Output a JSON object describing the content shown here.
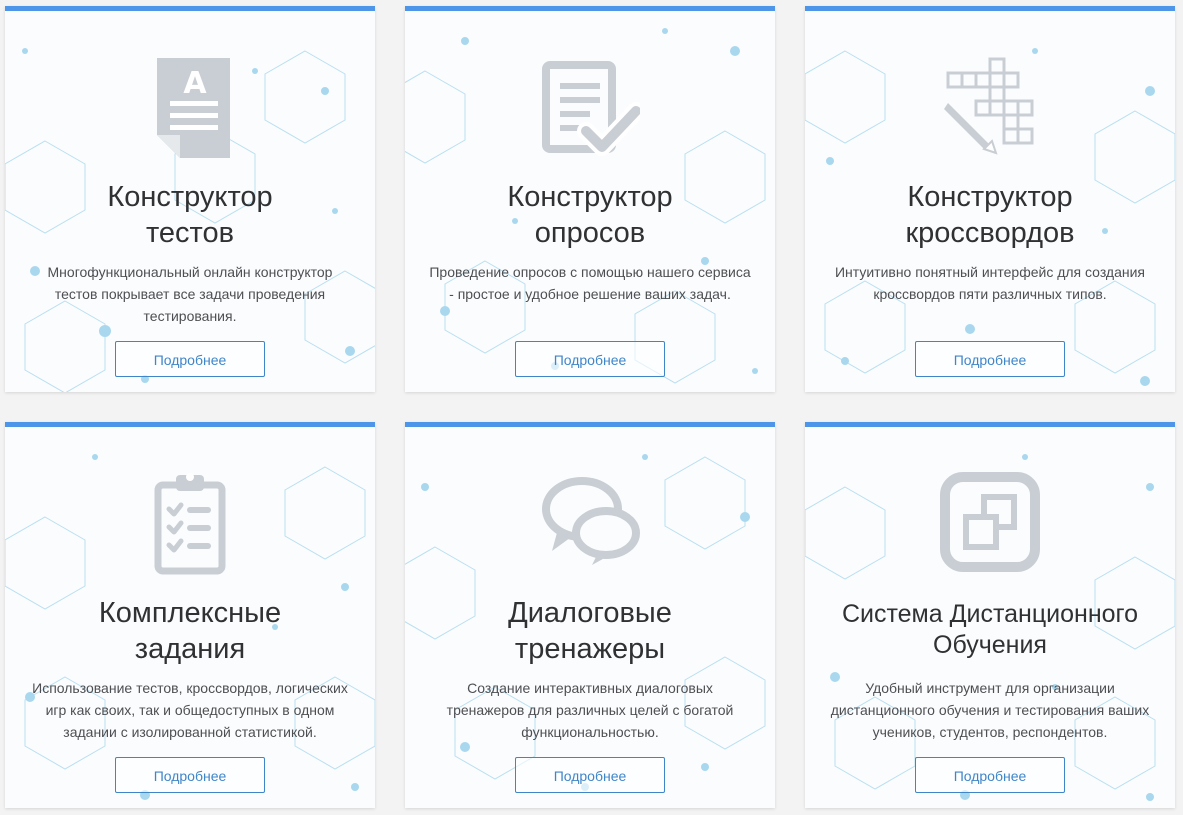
{
  "cards": [
    {
      "title_line1": "Конструктор",
      "title_line2": "тестов",
      "description": "Многофункциональный онлайн конструктор тестов покрывает все задачи проведения тестирования.",
      "button": "Подробнее",
      "icon": "test-document-icon"
    },
    {
      "title_line1": "Конструктор",
      "title_line2": "опросов",
      "description": "Проведение опросов с помощью нашего сервиса - простое и удобное решение ваших задач.",
      "button": "Подробнее",
      "icon": "survey-check-icon"
    },
    {
      "title_line1": "Конструктор",
      "title_line2": "кроссвордов",
      "description": "Интуитивно понятный интерфейс для создания кроссвордов пяти различных типов.",
      "button": "Подробнее",
      "icon": "crossword-pencil-icon"
    },
    {
      "title_line1": "Комплексные",
      "title_line2": "задания",
      "description": "Использование тестов, кроссвордов, логических игр как своих, так и общедоступных в одном задании с изолированной статистикой.",
      "button": "Подробнее",
      "icon": "clipboard-checklist-icon"
    },
    {
      "title_line1": "Диалоговые",
      "title_line2": "тренажеры",
      "description": "Создание интерактивных диалоговых тренажеров для различных целей с богатой функциональностью.",
      "button": "Подробнее",
      "icon": "chat-bubbles-icon"
    },
    {
      "title_line1": "Система Дистанционного",
      "title_line2": "Обучения",
      "description": "Удобный инструмент для организации дистанционного обучения и тестирования ваших учеников, студентов, респондентов.",
      "button": "Подробнее",
      "icon": "distance-learning-windows-icon"
    }
  ],
  "colors": {
    "accent": "#4d95e8",
    "button_text": "#3f86c9",
    "icon": "#c9ced4",
    "pattern": "#9fd0ea"
  }
}
